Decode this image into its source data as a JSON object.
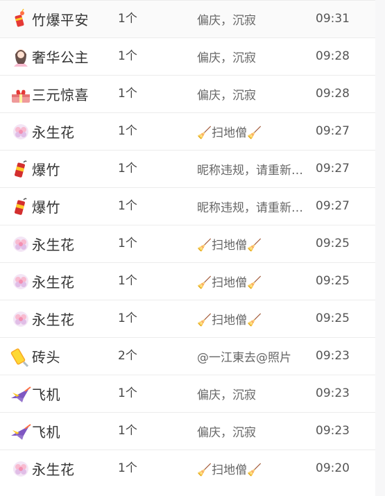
{
  "rows": [
    {
      "icon": "firecracker-peace-icon",
      "name": "竹爆平安",
      "count": "1个",
      "receiver": "偏庆，沉寂",
      "time": "09:31"
    },
    {
      "icon": "luxury-princess-icon",
      "name": "奢华公主",
      "count": "1个",
      "receiver": "偏庆，沉寂",
      "time": "09:28"
    },
    {
      "icon": "gift-box-surprise-icon",
      "name": "三元惊喜",
      "count": "1个",
      "receiver": "偏庆，沉寂",
      "time": "09:28"
    },
    {
      "icon": "eternal-flower-icon",
      "name": "永生花",
      "count": "1个",
      "receiver": "🧹扫地僧🧹",
      "time": "09:27"
    },
    {
      "icon": "firecracker-icon",
      "name": "爆竹",
      "count": "1个",
      "receiver": "昵称违规，请重新设置",
      "time": "09:27"
    },
    {
      "icon": "firecracker-icon",
      "name": "爆竹",
      "count": "1个",
      "receiver": "昵称违规，请重新设置",
      "time": "09:27"
    },
    {
      "icon": "eternal-flower-icon",
      "name": "永生花",
      "count": "1个",
      "receiver": "🧹扫地僧🧹",
      "time": "09:25"
    },
    {
      "icon": "eternal-flower-icon",
      "name": "永生花",
      "count": "1个",
      "receiver": "🧹扫地僧🧹",
      "time": "09:25"
    },
    {
      "icon": "eternal-flower-icon",
      "name": "永生花",
      "count": "1个",
      "receiver": "🧹扫地僧🧹",
      "time": "09:25"
    },
    {
      "icon": "brick-icon",
      "name": "砖头",
      "count": "2个",
      "receiver": "@一江東去@照片",
      "time": "09:23"
    },
    {
      "icon": "airplane-icon",
      "name": "飞机",
      "count": "1个",
      "receiver": "偏庆，沉寂",
      "time": "09:23"
    },
    {
      "icon": "airplane-icon",
      "name": "飞机",
      "count": "1个",
      "receiver": "偏庆，沉寂",
      "time": "09:23"
    },
    {
      "icon": "eternal-flower-icon",
      "name": "永生花",
      "count": "1个",
      "receiver": "🧹扫地僧🧹",
      "time": "09:20"
    }
  ]
}
